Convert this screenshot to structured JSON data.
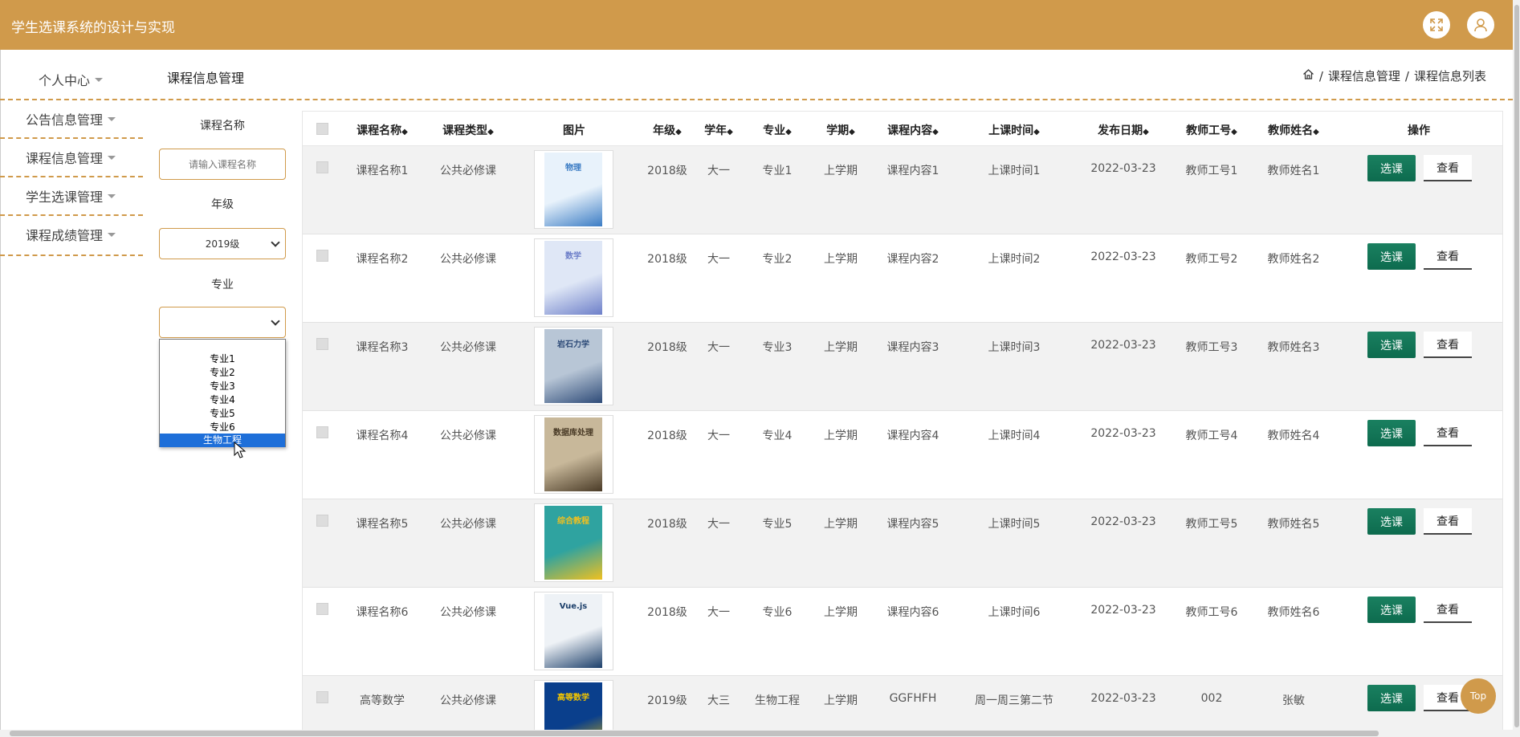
{
  "header": {
    "title": "学生选课系统的设计与实现",
    "fullscreen_icon": "expand-icon",
    "user_icon": "user-icon"
  },
  "sidebar": {
    "items": [
      {
        "label": "个人中心"
      },
      {
        "label": "公告信息管理"
      },
      {
        "label": "课程信息管理"
      },
      {
        "label": "学生选课管理"
      },
      {
        "label": "课程成绩管理"
      }
    ]
  },
  "page": {
    "title": "课程信息管理"
  },
  "breadcrumb": {
    "home_icon": "home-icon",
    "sep": "/",
    "level1": "课程信息管理",
    "level2": "课程信息列表"
  },
  "search": {
    "name_label": "课程名称",
    "name_placeholder": "请输入课程名称",
    "grade_label": "年级",
    "grade_value": "2019级",
    "major_label": "专业",
    "major_value": "",
    "major_options": [
      "专业1",
      "专业2",
      "专业3",
      "专业4",
      "专业5",
      "专业6",
      "生物工程"
    ],
    "major_highlighted": "生物工程"
  },
  "table": {
    "headers": [
      "课程名称",
      "课程类型",
      "图片",
      "年级",
      "学年",
      "专业",
      "学期",
      "课程内容",
      "上课时间",
      "发布日期",
      "教师工号",
      "教师姓名",
      "操作"
    ],
    "sort_icon": "◆",
    "pick_label": "选课",
    "view_label": "查看",
    "rows": [
      {
        "name": "课程名称1",
        "type": "公共必修课",
        "grade": "2018级",
        "year": "大一",
        "major": "专业1",
        "term": "上学期",
        "content": "课程内容1",
        "time": "上课时间1",
        "date": "2022-03-23",
        "tid": "教师工号1",
        "tname": "教师姓名1",
        "book_title": "物理"
      },
      {
        "name": "课程名称2",
        "type": "公共必修课",
        "grade": "2018级",
        "year": "大一",
        "major": "专业2",
        "term": "上学期",
        "content": "课程内容2",
        "time": "上课时间2",
        "date": "2022-03-23",
        "tid": "教师工号2",
        "tname": "教师姓名2",
        "book_title": "数学"
      },
      {
        "name": "课程名称3",
        "type": "公共必修课",
        "grade": "2018级",
        "year": "大一",
        "major": "专业3",
        "term": "上学期",
        "content": "课程内容3",
        "time": "上课时间3",
        "date": "2022-03-23",
        "tid": "教师工号3",
        "tname": "教师姓名3",
        "book_title": "岩石力学"
      },
      {
        "name": "课程名称4",
        "type": "公共必修课",
        "grade": "2018级",
        "year": "大一",
        "major": "专业4",
        "term": "上学期",
        "content": "课程内容4",
        "time": "上课时间4",
        "date": "2022-03-23",
        "tid": "教师工号4",
        "tname": "教师姓名4",
        "book_title": "数据库处理"
      },
      {
        "name": "课程名称5",
        "type": "公共必修课",
        "grade": "2018级",
        "year": "大一",
        "major": "专业5",
        "term": "上学期",
        "content": "课程内容5",
        "time": "上课时间5",
        "date": "2022-03-23",
        "tid": "教师工号5",
        "tname": "教师姓名5",
        "book_title": "综合教程"
      },
      {
        "name": "课程名称6",
        "type": "公共必修课",
        "grade": "2018级",
        "year": "大一",
        "major": "专业6",
        "term": "上学期",
        "content": "课程内容6",
        "time": "上课时间6",
        "date": "2022-03-23",
        "tid": "教师工号6",
        "tname": "教师姓名6",
        "book_title": "Vue.js"
      },
      {
        "name": "高等数学",
        "type": "公共必修课",
        "grade": "2019级",
        "year": "大三",
        "major": "生物工程",
        "term": "上学期",
        "content": "GGFHFH",
        "time": "周一周三第二节",
        "date": "2022-03-23",
        "tid": "002",
        "tname": "张敏",
        "book_title": "高等数学"
      }
    ]
  },
  "back_to_top": "Top",
  "colors": {
    "accent": "#d09a4b",
    "button_green": "#0d6b4e",
    "selection_blue": "#1e6fd9"
  }
}
